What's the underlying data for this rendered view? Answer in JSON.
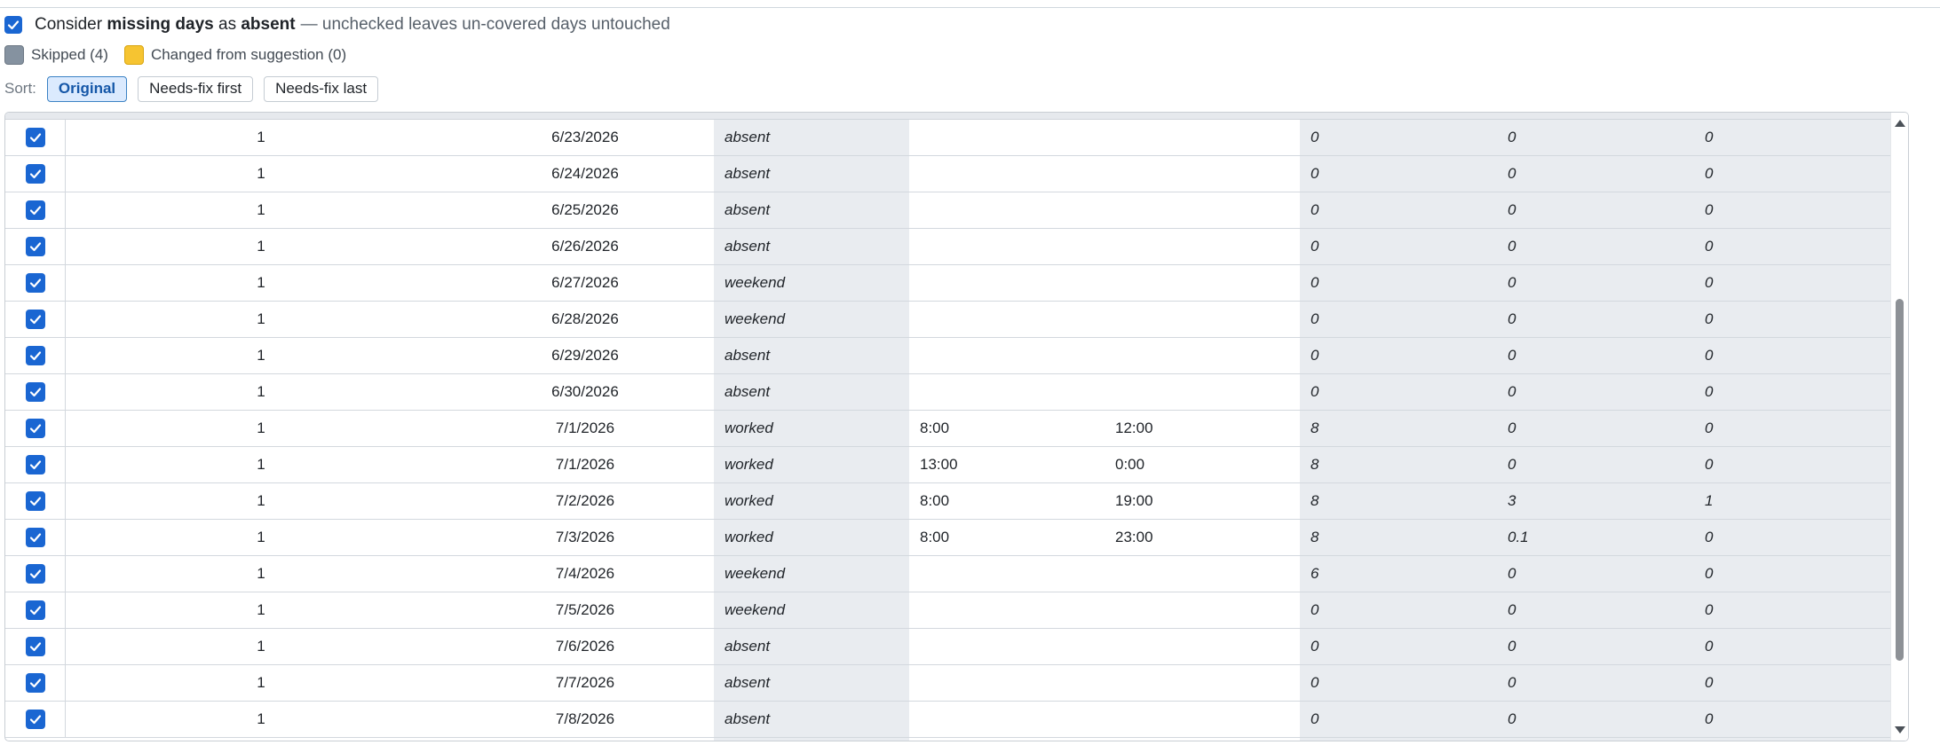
{
  "options": {
    "absent_checkbox_checked": true,
    "absent_prefix": "Consider",
    "absent_bold1": "missing days",
    "absent_mid": "as",
    "absent_bold2": "absent",
    "absent_hint": "— unchecked leaves un-covered days untouched"
  },
  "legend": {
    "skipped_label": "Skipped (4)",
    "skipped_color": "#8592a0",
    "changed_label": "Changed from suggestion (0)",
    "changed_color": "#f6c431"
  },
  "sort": {
    "label": "Sort:",
    "buttons": [
      "Original",
      "Needs-fix first",
      "Needs-fix last"
    ],
    "active": "Original"
  },
  "colors": {
    "accent": "#1a66d2",
    "shaded_column": "#e9ecf0"
  },
  "rows": [
    {
      "selected": true,
      "id": "1",
      "date": "6/23/2026",
      "status": "absent",
      "in": "",
      "out": "",
      "regular": "0",
      "overtime": "0",
      "double": "0"
    },
    {
      "selected": true,
      "id": "1",
      "date": "6/24/2026",
      "status": "absent",
      "in": "",
      "out": "",
      "regular": "0",
      "overtime": "0",
      "double": "0"
    },
    {
      "selected": true,
      "id": "1",
      "date": "6/25/2026",
      "status": "absent",
      "in": "",
      "out": "",
      "regular": "0",
      "overtime": "0",
      "double": "0"
    },
    {
      "selected": true,
      "id": "1",
      "date": "6/26/2026",
      "status": "absent",
      "in": "",
      "out": "",
      "regular": "0",
      "overtime": "0",
      "double": "0"
    },
    {
      "selected": true,
      "id": "1",
      "date": "6/27/2026",
      "status": "weekend",
      "in": "",
      "out": "",
      "regular": "0",
      "overtime": "0",
      "double": "0"
    },
    {
      "selected": true,
      "id": "1",
      "date": "6/28/2026",
      "status": "weekend",
      "in": "",
      "out": "",
      "regular": "0",
      "overtime": "0",
      "double": "0"
    },
    {
      "selected": true,
      "id": "1",
      "date": "6/29/2026",
      "status": "absent",
      "in": "",
      "out": "",
      "regular": "0",
      "overtime": "0",
      "double": "0"
    },
    {
      "selected": true,
      "id": "1",
      "date": "6/30/2026",
      "status": "absent",
      "in": "",
      "out": "",
      "regular": "0",
      "overtime": "0",
      "double": "0"
    },
    {
      "selected": true,
      "id": "1",
      "date": "7/1/2026",
      "status": "worked",
      "in": "8:00",
      "out": "12:00",
      "regular": "8",
      "overtime": "0",
      "double": "0"
    },
    {
      "selected": true,
      "id": "1",
      "date": "7/1/2026",
      "status": "worked",
      "in": "13:00",
      "out": "0:00",
      "regular": "8",
      "overtime": "0",
      "double": "0"
    },
    {
      "selected": true,
      "id": "1",
      "date": "7/2/2026",
      "status": "worked",
      "in": "8:00",
      "out": "19:00",
      "regular": "8",
      "overtime": "3",
      "double": "1"
    },
    {
      "selected": true,
      "id": "1",
      "date": "7/3/2026",
      "status": "worked",
      "in": "8:00",
      "out": "23:00",
      "regular": "8",
      "overtime": "0.1",
      "double": "0"
    },
    {
      "selected": true,
      "id": "1",
      "date": "7/4/2026",
      "status": "weekend",
      "in": "",
      "out": "",
      "regular": "6",
      "overtime": "0",
      "double": "0"
    },
    {
      "selected": true,
      "id": "1",
      "date": "7/5/2026",
      "status": "weekend",
      "in": "",
      "out": "",
      "regular": "0",
      "overtime": "0",
      "double": "0"
    },
    {
      "selected": true,
      "id": "1",
      "date": "7/6/2026",
      "status": "absent",
      "in": "",
      "out": "",
      "regular": "0",
      "overtime": "0",
      "double": "0"
    },
    {
      "selected": true,
      "id": "1",
      "date": "7/7/2026",
      "status": "absent",
      "in": "",
      "out": "",
      "regular": "0",
      "overtime": "0",
      "double": "0"
    },
    {
      "selected": true,
      "id": "1",
      "date": "7/8/2026",
      "status": "absent",
      "in": "",
      "out": "",
      "regular": "0",
      "overtime": "0",
      "double": "0"
    }
  ]
}
